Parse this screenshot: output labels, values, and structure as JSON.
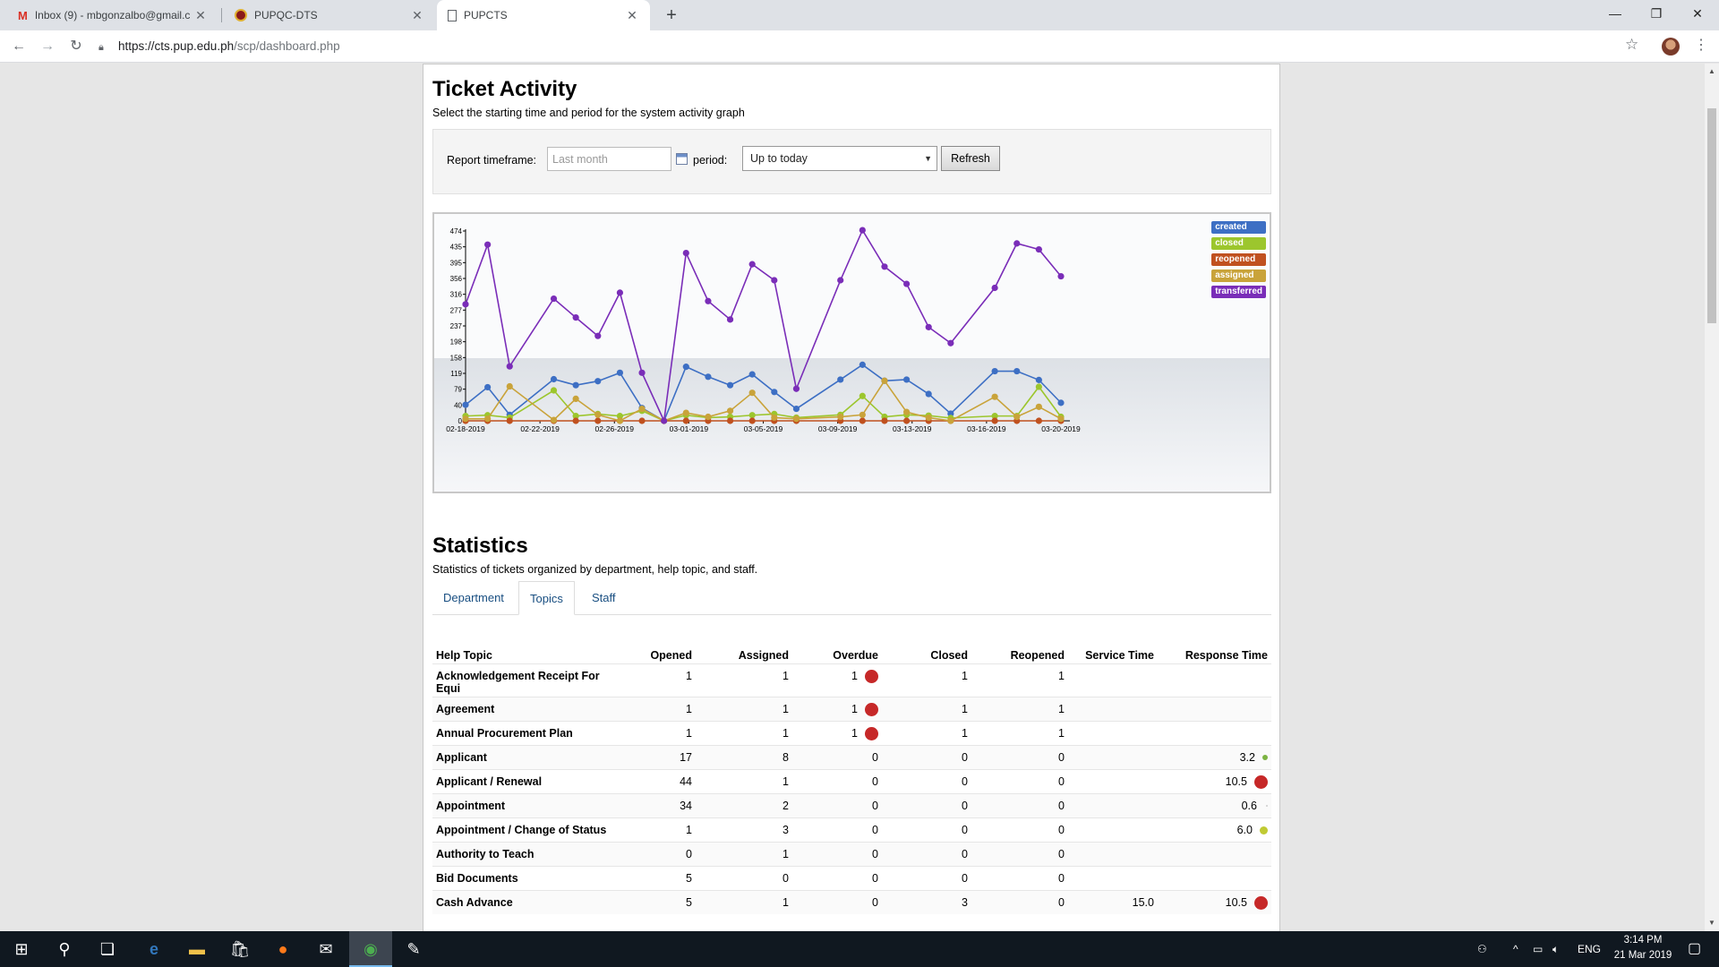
{
  "browser": {
    "tabs": [
      {
        "title": "Inbox (9) - mbgonzalbo@gmail.c",
        "icon": "gmail-icon"
      },
      {
        "title": "PUPQC-DTS",
        "icon": "pup-logo-icon"
      },
      {
        "title": "PUPCTS",
        "icon": "page-icon"
      }
    ],
    "new_tab": "+",
    "url_host": "https://cts.pup.edu.ph",
    "url_path": "/scp/dashboard.php"
  },
  "activity": {
    "title": "Ticket Activity",
    "subtitle": "Select the starting time and period for the system activity graph",
    "timeframe_label": "Report timeframe:",
    "timeframe_placeholder": "Last month",
    "period_label": "period:",
    "period_value": "Up to today",
    "refresh_label": "Refresh"
  },
  "chart_data": {
    "type": "line",
    "x": [
      "02-18-2019",
      "02-19-2019",
      "02-20-2019",
      "02-21-2019",
      "02-22-2019",
      "02-23-2019",
      "02-24-2019",
      "02-25-2019",
      "02-26-2019",
      "02-27-2019",
      "02-28-2019",
      "03-01-2019",
      "03-02-2019",
      "03-03-2019",
      "03-04-2019",
      "03-05-2019",
      "03-06-2019",
      "03-07-2019",
      "03-08-2019",
      "03-09-2019",
      "03-10-2019",
      "03-11-2019",
      "03-12-2019",
      "03-13-2019",
      "03-14-2019",
      "03-15-2019",
      "03-16-2019",
      "03-17-2019",
      "03-18-2019",
      "03-19-2019",
      "03-20-2019"
    ],
    "x_tick_labels": [
      "02-18-2019",
      "02-22-2019",
      "02-26-2019",
      "03-01-2019",
      "03-05-2019",
      "03-09-2019",
      "03-13-2019",
      "03-16-2019",
      "03-20-2019"
    ],
    "y_tick_labels": [
      "0",
      "40",
      "79",
      "119",
      "158",
      "198",
      "237",
      "277",
      "316",
      "356",
      "395",
      "435",
      "474"
    ],
    "ylim": [
      0,
      474
    ],
    "grid": false,
    "legend_position": "top-right",
    "series": [
      {
        "name": "created",
        "color": "#3d6fc4",
        "values": [
          40,
          84,
          15,
          null,
          104,
          89,
          99,
          120,
          32,
          0,
          135,
          110,
          89,
          116,
          72,
          30,
          null,
          103,
          140,
          100,
          103,
          67,
          18,
          null,
          124,
          124,
          102,
          45
        ]
      },
      {
        "name": "closed",
        "color": "#9cc62d",
        "values": [
          12,
          14,
          8,
          null,
          76,
          12,
          17,
          12,
          25,
          0,
          14,
          8,
          10,
          14,
          17,
          8,
          null,
          15,
          62,
          10,
          15,
          13,
          7,
          null,
          12,
          12,
          85,
          10
        ]
      },
      {
        "name": "reopened",
        "color": "#c0511f",
        "values": [
          0,
          0,
          0,
          null,
          0,
          0,
          0,
          0,
          0,
          0,
          0,
          0,
          0,
          0,
          0,
          0,
          null,
          0,
          0,
          0,
          0,
          0,
          0,
          null,
          0,
          0,
          0,
          0
        ]
      },
      {
        "name": "assigned",
        "color": "#c9a33a",
        "values": [
          5,
          5,
          86,
          null,
          2,
          55,
          15,
          0,
          30,
          0,
          20,
          10,
          25,
          70,
          8,
          5,
          null,
          10,
          15,
          100,
          22,
          8,
          0,
          null,
          60,
          10,
          35,
          5
        ]
      },
      {
        "name": "transferred",
        "color": "#7a2db8",
        "values": [
          291,
          440,
          136,
          null,
          305,
          258,
          212,
          320,
          120,
          0,
          419,
          299,
          253,
          391,
          351,
          80,
          null,
          351,
          476,
          385,
          342,
          234,
          194,
          null,
          332,
          443,
          428,
          361
        ]
      }
    ]
  },
  "statistics": {
    "title": "Statistics",
    "subtitle": "Statistics of tickets organized by department, help topic, and staff.",
    "tabs": [
      "Department",
      "Topics",
      "Staff"
    ],
    "active_tab": "Topics",
    "columns": [
      "Help Topic",
      "Opened",
      "Assigned",
      "Overdue",
      "Closed",
      "Reopened",
      "Service Time",
      "Response Time"
    ],
    "rows": [
      {
        "topic": "Acknowledgement Receipt For Equi",
        "opened": "1",
        "assigned": "1",
        "overdue": "1",
        "closed": "1",
        "reopened": "1",
        "service": "",
        "response": "",
        "overdue_flag": "big"
      },
      {
        "topic": "Agreement",
        "opened": "1",
        "assigned": "1",
        "overdue": "1",
        "closed": "1",
        "reopened": "1",
        "service": "",
        "response": "",
        "overdue_flag": "big"
      },
      {
        "topic": "Annual Procurement Plan",
        "opened": "1",
        "assigned": "1",
        "overdue": "1",
        "closed": "1",
        "reopened": "1",
        "service": "",
        "response": "",
        "overdue_flag": "big"
      },
      {
        "topic": "Applicant",
        "opened": "17",
        "assigned": "8",
        "overdue": "0",
        "closed": "0",
        "reopened": "0",
        "service": "",
        "response": "3.2",
        "response_flag": "sm"
      },
      {
        "topic": "Applicant / Renewal",
        "opened": "44",
        "assigned": "1",
        "overdue": "0",
        "closed": "0",
        "reopened": "0",
        "service": "",
        "response": "10.5",
        "response_flag": "big"
      },
      {
        "topic": "Appointment",
        "opened": "34",
        "assigned": "2",
        "overdue": "0",
        "closed": "0",
        "reopened": "0",
        "service": "",
        "response": "0.6",
        "response_flag": "tiny"
      },
      {
        "topic": "Appointment / Change of Status",
        "opened": "1",
        "assigned": "3",
        "overdue": "0",
        "closed": "0",
        "reopened": "0",
        "service": "",
        "response": "6.0",
        "response_flag": "md"
      },
      {
        "topic": "Authority to Teach",
        "opened": "0",
        "assigned": "1",
        "overdue": "0",
        "closed": "0",
        "reopened": "0",
        "service": "",
        "response": ""
      },
      {
        "topic": "Bid Documents",
        "opened": "5",
        "assigned": "0",
        "overdue": "0",
        "closed": "0",
        "reopened": "0",
        "service": "",
        "response": ""
      },
      {
        "topic": "Cash Advance",
        "opened": "5",
        "assigned": "1",
        "overdue": "0",
        "closed": "3",
        "reopened": "0",
        "service": "15.0",
        "response": "10.5",
        "response_flag": "big"
      }
    ]
  },
  "taskbar": {
    "lang": "ENG",
    "time": "3:14 PM",
    "date": "21 Mar 2019"
  }
}
